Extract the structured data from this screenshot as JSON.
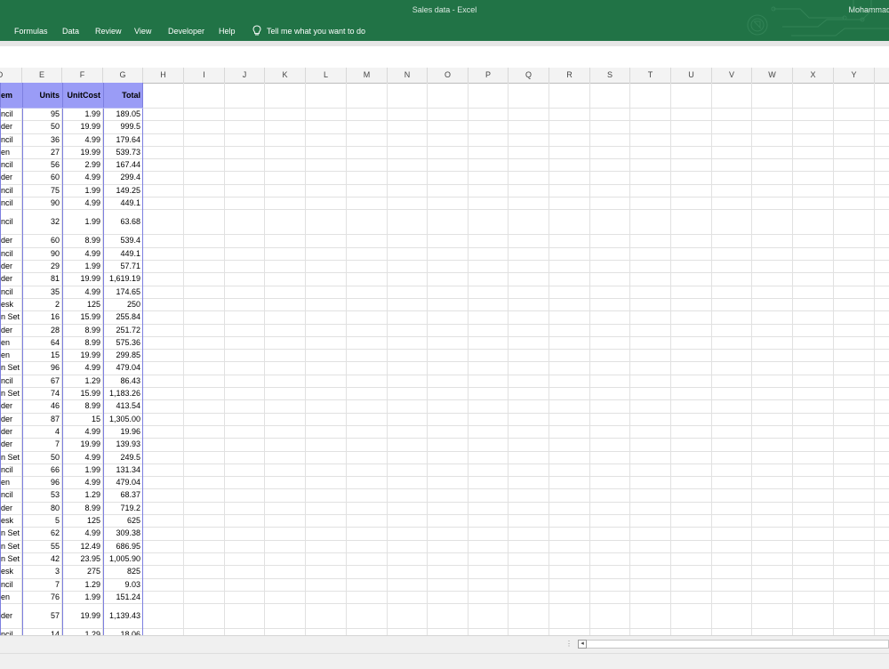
{
  "window": {
    "title": "Sales data  -  Excel",
    "user": "Mohammad"
  },
  "menu": {
    "items": [
      "Formulas",
      "Data",
      "Review",
      "View",
      "Developer",
      "Help"
    ],
    "tell_me": "Tell me what you want to do"
  },
  "columns": [
    "D",
    "E",
    "F",
    "G",
    "H",
    "I",
    "J",
    "K",
    "L",
    "M",
    "N",
    "O",
    "P",
    "Q",
    "R",
    "S",
    "T",
    "U",
    "V",
    "W",
    "X",
    "Y"
  ],
  "table": {
    "headers": {
      "item": "em",
      "units": "Units",
      "unitcost": "UnitCost",
      "total": "Total"
    },
    "rows": [
      [
        "ncil",
        "95",
        "1.99",
        "189.05"
      ],
      [
        "der",
        "50",
        "19.99",
        "999.5"
      ],
      [
        "ncil",
        "36",
        "4.99",
        "179.64"
      ],
      [
        "en",
        "27",
        "19.99",
        "539.73"
      ],
      [
        "ncil",
        "56",
        "2.99",
        "167.44"
      ],
      [
        "der",
        "60",
        "4.99",
        "299.4"
      ],
      [
        "ncil",
        "75",
        "1.99",
        "149.25"
      ],
      [
        "ncil",
        "90",
        "4.99",
        "449.1"
      ],
      [
        "ncil",
        "32",
        "1.99",
        "63.68"
      ],
      [
        "der",
        "60",
        "8.99",
        "539.4"
      ],
      [
        "ncil",
        "90",
        "4.99",
        "449.1"
      ],
      [
        "der",
        "29",
        "1.99",
        "57.71"
      ],
      [
        "der",
        "81",
        "19.99",
        "1,619.19"
      ],
      [
        "ncil",
        "35",
        "4.99",
        "174.65"
      ],
      [
        "esk",
        "2",
        "125",
        "250"
      ],
      [
        "n Set",
        "16",
        "15.99",
        "255.84"
      ],
      [
        "der",
        "28",
        "8.99",
        "251.72"
      ],
      [
        "en",
        "64",
        "8.99",
        "575.36"
      ],
      [
        "en",
        "15",
        "19.99",
        "299.85"
      ],
      [
        "n Set",
        "96",
        "4.99",
        "479.04"
      ],
      [
        "ncil",
        "67",
        "1.29",
        "86.43"
      ],
      [
        "n Set",
        "74",
        "15.99",
        "1,183.26"
      ],
      [
        "der",
        "46",
        "8.99",
        "413.54"
      ],
      [
        "der",
        "87",
        "15",
        "1,305.00"
      ],
      [
        "der",
        "4",
        "4.99",
        "19.96"
      ],
      [
        "der",
        "7",
        "19.99",
        "139.93"
      ],
      [
        "n Set",
        "50",
        "4.99",
        "249.5"
      ],
      [
        "ncil",
        "66",
        "1.99",
        "131.34"
      ],
      [
        "en",
        "96",
        "4.99",
        "479.04"
      ],
      [
        "ncil",
        "53",
        "1.29",
        "68.37"
      ],
      [
        "der",
        "80",
        "8.99",
        "719.2"
      ],
      [
        "esk",
        "5",
        "125",
        "625"
      ],
      [
        "n Set",
        "62",
        "4.99",
        "309.38"
      ],
      [
        "n Set",
        "55",
        "12.49",
        "686.95"
      ],
      [
        "n Set",
        "42",
        "23.95",
        "1,005.90"
      ],
      [
        "esk",
        "3",
        "275",
        "825"
      ],
      [
        "ncil",
        "7",
        "1.29",
        "9.03"
      ],
      [
        "en",
        "76",
        "1.99",
        "151.24"
      ],
      [
        "der",
        "57",
        "19.99",
        "1,139.43"
      ],
      [
        "ncil",
        "14",
        "1.29",
        "18.06"
      ]
    ]
  }
}
